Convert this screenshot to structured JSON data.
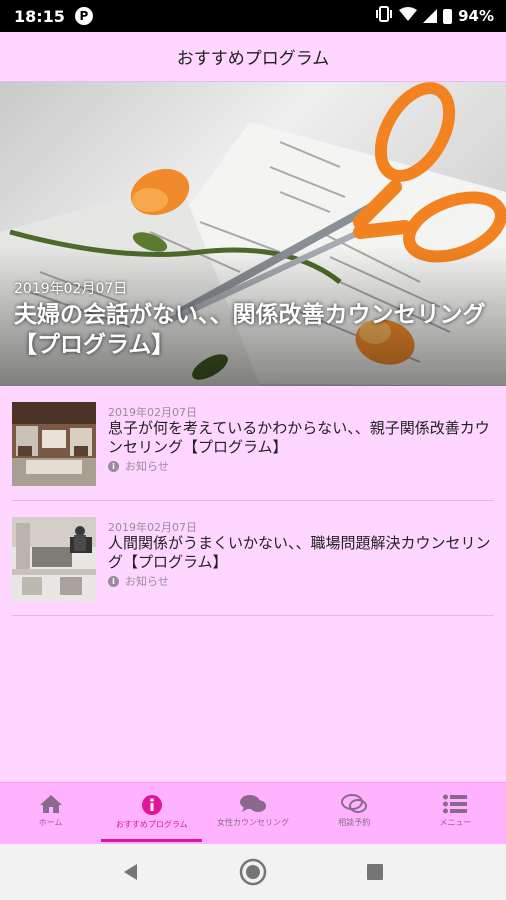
{
  "status_bar": {
    "time": "18:15",
    "app_indicator": "P",
    "battery": "94%",
    "icons": [
      "vibrate-icon",
      "wifi-icon",
      "signal-icon",
      "battery-icon"
    ]
  },
  "app_bar": {
    "title": "おすすめプログラム"
  },
  "featured": {
    "date": "2019年02月07日",
    "title": "夫婦の会話がない、、関係改善カウンセリング【プログラム】"
  },
  "articles": [
    {
      "date": "2019年02月07日",
      "title": "息子が何を考えているかわからない、、親子関係改善カウンセリング【プログラム】",
      "category": "お知らせ"
    },
    {
      "date": "2019年02月07日",
      "title": "人間関係がうまくいかない、、職場問題解決カウンセリング【プログラム】",
      "category": "お知らせ"
    }
  ],
  "tabs": [
    {
      "label": "ホーム",
      "icon": "home-icon",
      "active": false
    },
    {
      "label": "おすすめプログラム",
      "icon": "info-icon",
      "active": true
    },
    {
      "label": "女性カウンセリング",
      "icon": "chat-bubbles-icon",
      "active": false
    },
    {
      "label": "相談予約",
      "icon": "chat-outline-icon",
      "active": false
    },
    {
      "label": "メニュー",
      "icon": "list-menu-icon",
      "active": false
    }
  ],
  "colors": {
    "background": "#ffd6ff",
    "tab_bar": "#ffb3ff",
    "accent": "#e0159a"
  },
  "nav_bar": {
    "buttons": [
      "back-icon",
      "home-circle-icon",
      "recents-icon"
    ]
  }
}
